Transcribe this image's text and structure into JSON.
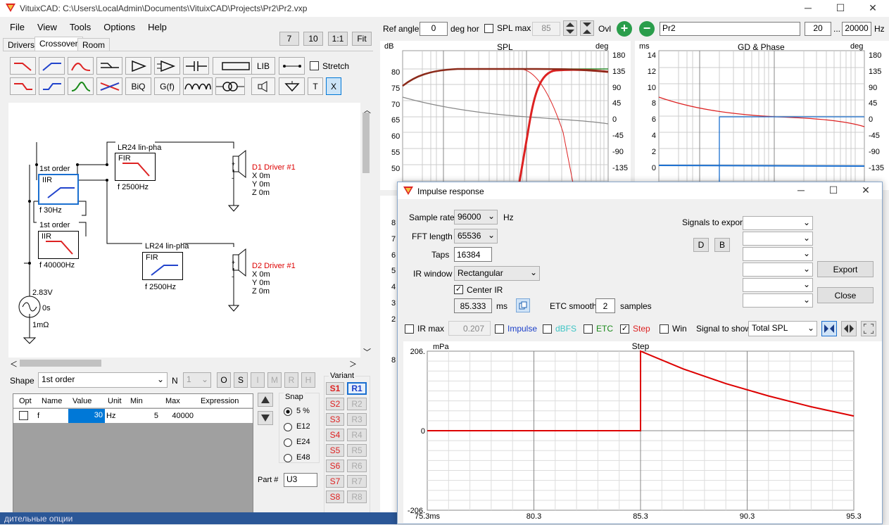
{
  "window": {
    "title": "VituixCAD: C:\\Users\\LocalAdmin\\Documents\\VituixCAD\\Projects\\Pr2\\Pr2.vxp"
  },
  "menu": [
    "File",
    "View",
    "Tools",
    "Options",
    "Help"
  ],
  "zoom_buttons": [
    "7",
    "10",
    "1:1",
    "Fit"
  ],
  "tabs": [
    "Drivers",
    "Crossover",
    "Room"
  ],
  "toolbar": {
    "lib": "LIB",
    "biq": "BiQ",
    "gf": "G(f)",
    "t": "T",
    "x": "X",
    "stretch": "Stretch"
  },
  "schematic": {
    "b1": {
      "title": "LR24 lin-pha",
      "type": "FIR",
      "freq": "f   2500Hz"
    },
    "b2": {
      "title": "1st order",
      "type": "IIR",
      "freq": "f   30Hz"
    },
    "b3": {
      "title": "1st order",
      "type": "IIR",
      "freq": "f   40000Hz"
    },
    "b4": {
      "title": "LR24 lin-pha",
      "type": "FIR",
      "freq": "f   2500Hz"
    },
    "d1": {
      "name": "D1 Driver #1",
      "x": "X 0m",
      "y": "Y 0m",
      "z": "Z 0m"
    },
    "d2": {
      "name": "D2 Driver #1",
      "x": "X 0m",
      "y": "Y 0m",
      "z": "Z 0m"
    },
    "src": {
      "v": "2.83V",
      "t": "0s",
      "r": "1mΩ"
    }
  },
  "shape": {
    "label": "Shape",
    "value": "1st order",
    "n_label": "N",
    "n_value": "1",
    "btns": [
      "O",
      "S",
      "I",
      "M",
      "R",
      "H"
    ]
  },
  "params": {
    "headers": [
      "Opt",
      "Name",
      "Value",
      "Unit",
      "Min",
      "Max",
      "Expression"
    ],
    "row": {
      "name": "f",
      "value": "30",
      "unit": "Hz",
      "min": "5",
      "max": "40000"
    }
  },
  "snap": {
    "label": "Snap",
    "options": [
      "5 %",
      "E12",
      "E24",
      "E48"
    ]
  },
  "part": {
    "label": "Part #",
    "value": "U3"
  },
  "variant": {
    "label": "Variant",
    "s": [
      "S1",
      "S2",
      "S3",
      "S4",
      "S5",
      "S6",
      "S7",
      "S8"
    ],
    "r": [
      "R1",
      "R2",
      "R3",
      "R4",
      "R5",
      "R6",
      "R7",
      "R8"
    ]
  },
  "top_controls": {
    "ref_angle_label": "Ref angle",
    "ref_angle": "0",
    "deg_hor": "deg hor",
    "spl_max": "SPL max",
    "spl_max_val": "85",
    "ovl": "Ovl",
    "name": "Pr2",
    "f_from": "20",
    "dots": "...",
    "f_to": "20000",
    "hz": "Hz"
  },
  "spl_chart": {
    "title": "SPL",
    "left_unit": "dB",
    "right_unit": "deg",
    "left_ticks": [
      "80",
      "75",
      "70",
      "65",
      "60",
      "55",
      "50"
    ],
    "right_ticks": [
      "180",
      "135",
      "90",
      "45",
      "0",
      "-45",
      "-90",
      "-135"
    ]
  },
  "gd_chart": {
    "title": "GD & Phase",
    "left_unit": "ms",
    "right_unit": "deg",
    "left_ticks": [
      "14",
      "12",
      "10",
      "8",
      "6",
      "4",
      "2",
      "0"
    ],
    "right_ticks": [
      "180",
      "135",
      "90",
      "45",
      "0",
      "-45",
      "-90",
      "-135"
    ]
  },
  "side_ticks": [
    "8",
    "7",
    "6",
    "5",
    "4",
    "3",
    "2",
    "8"
  ],
  "impulse": {
    "title": "Impulse response",
    "sample_rate_label": "Sample rate",
    "sample_rate": "96000",
    "hz": "Hz",
    "fft_label": "FFT length",
    "fft": "65536",
    "taps_label": "Taps",
    "taps": "16384",
    "irwin_label": "IR window",
    "irwin": "Rectangular",
    "center_ir": "Center IR",
    "ms_val": "85.333",
    "ms": "ms",
    "etc_label": "ETC smooth",
    "etc_val": "2",
    "samples": "samples",
    "signals_export": "Signals to export",
    "d": "D",
    "b": "B",
    "export": "Export",
    "close": "Close",
    "ir_max": "IR max",
    "ir_max_val": "0.207",
    "impulse_cb": "Impulse",
    "dbfs": "dBFS",
    "etc_cb": "ETC",
    "step_cb": "Step",
    "win_cb": "Win",
    "signal_show_label": "Signal to show",
    "signal_show": "Total SPL"
  },
  "chart_data": {
    "type": "line",
    "title": "Step",
    "ylabel": "mPa",
    "x_ticks": [
      "75.3ms",
      "80.3",
      "85.3",
      "90.3",
      "95.3"
    ],
    "y_ticks": [
      "206.",
      "0",
      "-206."
    ],
    "xlim": [
      75.3,
      95.3
    ],
    "ylim": [
      -206,
      206
    ],
    "series": [
      {
        "x": [
          75.3,
          85.3,
          85.3,
          87.3,
          89.3,
          91.3,
          93.3,
          95.3
        ],
        "y": [
          0,
          0,
          206,
          160,
          122,
          90,
          62,
          38
        ]
      }
    ]
  },
  "bottom_text": "дительные опции"
}
